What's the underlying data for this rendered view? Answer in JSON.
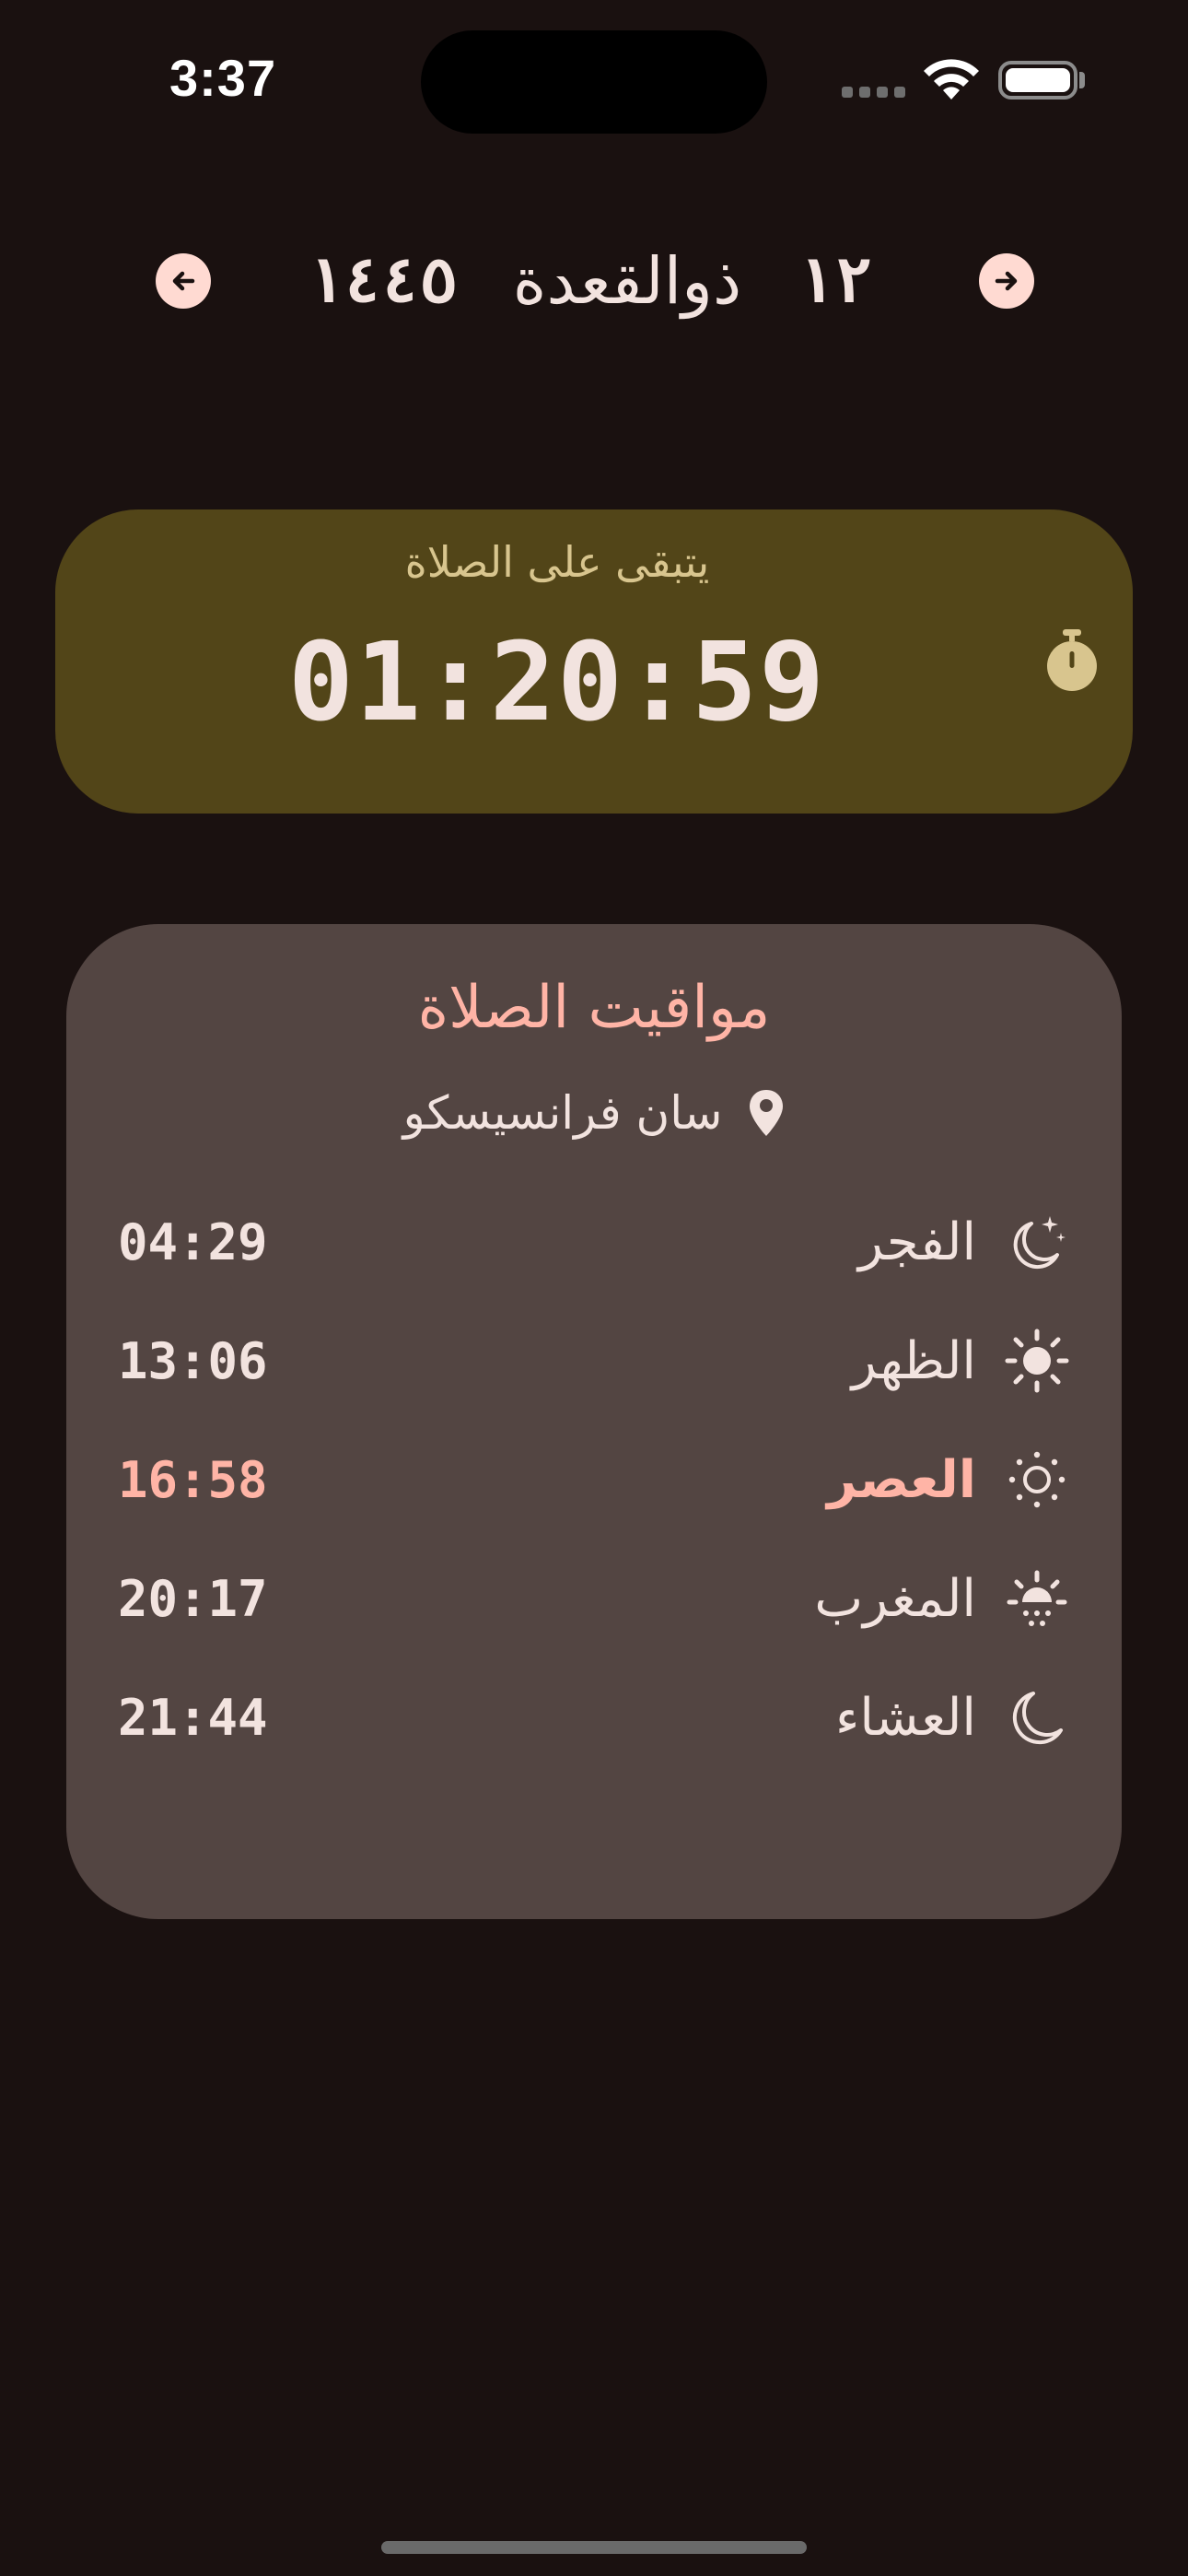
{
  "status_bar": {
    "time": "3:37"
  },
  "header": {
    "day": "١٢",
    "month": "ذوالقعدة",
    "year": "١٤٤٥",
    "prev_icon": "arrow-left-icon",
    "next_icon": "arrow-right-icon"
  },
  "countdown": {
    "label": "يتبقى على الصلاة",
    "time": "01:20:59",
    "icon": "timer-icon",
    "background": "#524518"
  },
  "prayer_times": {
    "title": "مواقيت الصلاة",
    "location": "سان فرانسيسكو",
    "accent": "#ffb4a6",
    "items": [
      {
        "name": "الفجر",
        "time": "04:29",
        "icon": "moon-stars-icon",
        "active": false
      },
      {
        "name": "الظهر",
        "time": "13:06",
        "icon": "sun-icon",
        "active": false
      },
      {
        "name": "العصر",
        "time": "16:58",
        "icon": "sun-outline-icon",
        "active": true
      },
      {
        "name": "المغرب",
        "time": "20:17",
        "icon": "sunset-icon",
        "active": false
      },
      {
        "name": "العشاء",
        "time": "21:44",
        "icon": "moon-icon",
        "active": false
      }
    ]
  }
}
